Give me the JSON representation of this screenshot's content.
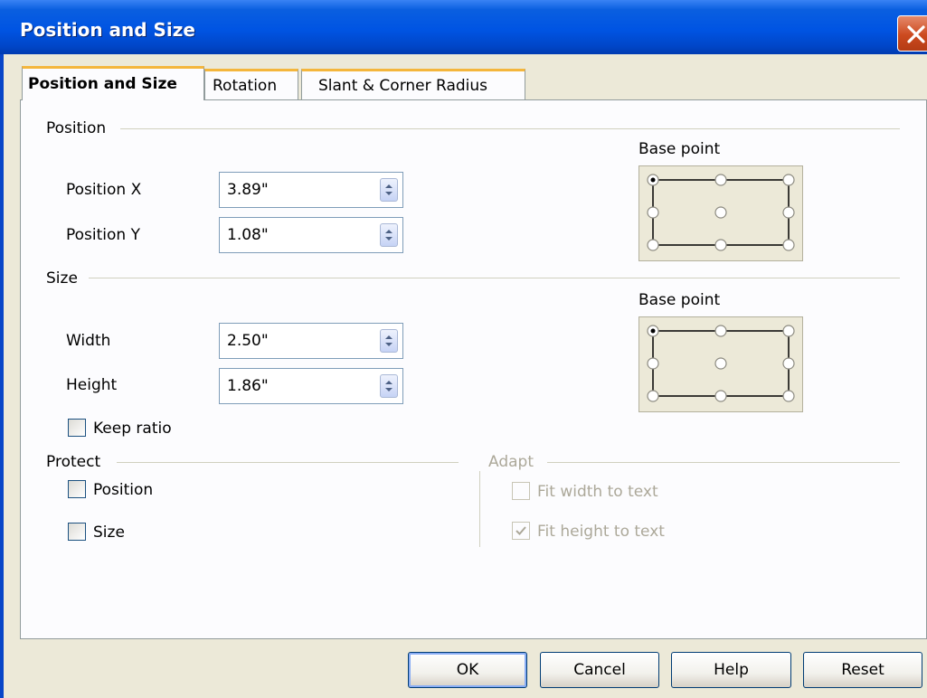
{
  "window": {
    "title": "Position and Size"
  },
  "tabs": [
    {
      "label": "Position and Size",
      "active": true
    },
    {
      "label": "Rotation",
      "active": false
    },
    {
      "label": "Slant & Corner Radius",
      "active": false
    }
  ],
  "position_section": {
    "heading": "Position",
    "x_label": "Position X",
    "x_value": "3.89\"",
    "y_label": "Position Y",
    "y_value": "1.08\"",
    "base_point_label": "Base point",
    "selected_base_point": "top-left"
  },
  "size_section": {
    "heading": "Size",
    "width_label": "Width",
    "width_value": "2.50\"",
    "height_label": "Height",
    "height_value": "1.86\"",
    "keep_ratio_label": "Keep ratio",
    "keep_ratio_checked": false,
    "base_point_label": "Base point",
    "selected_base_point": "top-left"
  },
  "protect_section": {
    "heading": "Protect",
    "position_label": "Position",
    "position_checked": false,
    "size_label": "Size",
    "size_checked": false
  },
  "adapt_section": {
    "heading": "Adapt",
    "fit_width_label": "Fit width to text",
    "fit_width_checked": false,
    "fit_height_label": "Fit height to text",
    "fit_height_checked": true,
    "disabled": true
  },
  "buttons": {
    "ok": "OK",
    "cancel": "Cancel",
    "help": "Help",
    "reset": "Reset"
  },
  "colors": {
    "titlebar": "#0054e3",
    "tab_highlight": "#f4b63c",
    "dialog_bg": "#ece9d8",
    "disabled_text": "#aca899"
  }
}
